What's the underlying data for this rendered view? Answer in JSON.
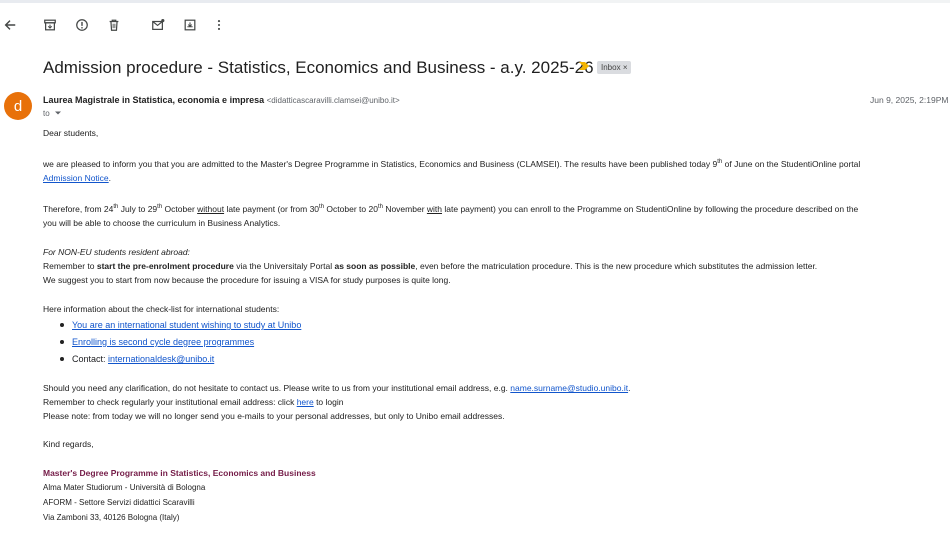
{
  "toolbar": {
    "icons": [
      "back-arrow-icon",
      "archive-icon",
      "report-icon",
      "delete-icon",
      "mark-unread-icon",
      "move-to-icon",
      "more-vert-icon"
    ]
  },
  "email": {
    "subject": "Admission procedure - Statistics, Economics and Business - a.y. 2025-26",
    "label": "Inbox",
    "label_close": "×",
    "sender_name": "Laurea Magistrale in Statistica, economia e impresa",
    "sender_email": "<didatticascaravilli.clamsei@unibo.it>",
    "date": "Jun 9, 2025, 2:19PM",
    "to": "to",
    "avatar_letter": "d"
  },
  "body": {
    "greeting": "Dear students,",
    "p1a": "we are pleased to inform you that you are admitted to the Master's Degree Programme in Statistics, Economics and Business (CLAMSEI). The results have been published today 9",
    "p1sup": "th",
    "p1b": " of June on the StudentiOnline portal",
    "p1link": "Admission Notice",
    "p1end": ".",
    "p2_t1": "Therefore, from 24",
    "p2_s1": "th",
    "p2_t2": " July to 29",
    "p2_s2": "th",
    "p2_t3": " October ",
    "p2_u1": "without",
    "p2_t4": " late payment (or from 30",
    "p2_s3": "th",
    "p2_t5": " October to 20",
    "p2_s4": "th",
    "p2_t6": " November ",
    "p2_u2": "with",
    "p2_t7": " late payment) you can enroll to the Programme on StudentiOnline by following the procedure described on the",
    "p2_line2": "you will be able to choose the curriculum in Business Analytics.",
    "p3_heading": "For NON-EU students resident abroad:",
    "p3_a": "Remember to ",
    "p3_b1": "start the pre-enrolment procedure",
    "p3_c": " via the Universitaly Portal ",
    "p3_b2": "as soon as possible",
    "p3_d": ", even before the matriculation procedure. This is the new procedure which substitutes the admission letter.",
    "p3_line2": "We suggest you to start from now because the procedure for issuing a VISA for study purposes is quite long.",
    "p4_intro": "Here information about the check-list for international students:",
    "checklist": {
      "item1": "You are an international student wishing to study at Unibo",
      "item2": "Enrolling is second cycle degree programmes",
      "item3_label": "Contact: ",
      "item3_link": "internationaldesk@unibo.it"
    },
    "p5_a": "Should you need any clarification, do not hesitate to contact us. Please write to us from your institutional email address, e.g. ",
    "p5_link": "name.surname@studio.unibo.it",
    "p5_end": ".",
    "p6_a": "Remember to check regularly your institutional email address: click ",
    "p6_link": "here",
    "p6_b": " to login",
    "p7": "Please note: from today we will no longer send you e-mails to your personal addresses, but only to Unibo email addresses.",
    "closing": "Kind regards,",
    "sig_title": "Master's Degree Programme in Statistics, Economics and Business",
    "sig_line1": "Alma Mater Studiorum - Università di Bologna",
    "sig_line2": "AFORM - Settore Servizi didattici Scaravilli",
    "sig_line3": "Via Zamboni 33, 40126 Bologna (Italy)"
  },
  "colors": {
    "avatar": "#e8710a",
    "link": "#1155cc",
    "signature": "#741b47",
    "importance_marker": "#f4b400"
  }
}
